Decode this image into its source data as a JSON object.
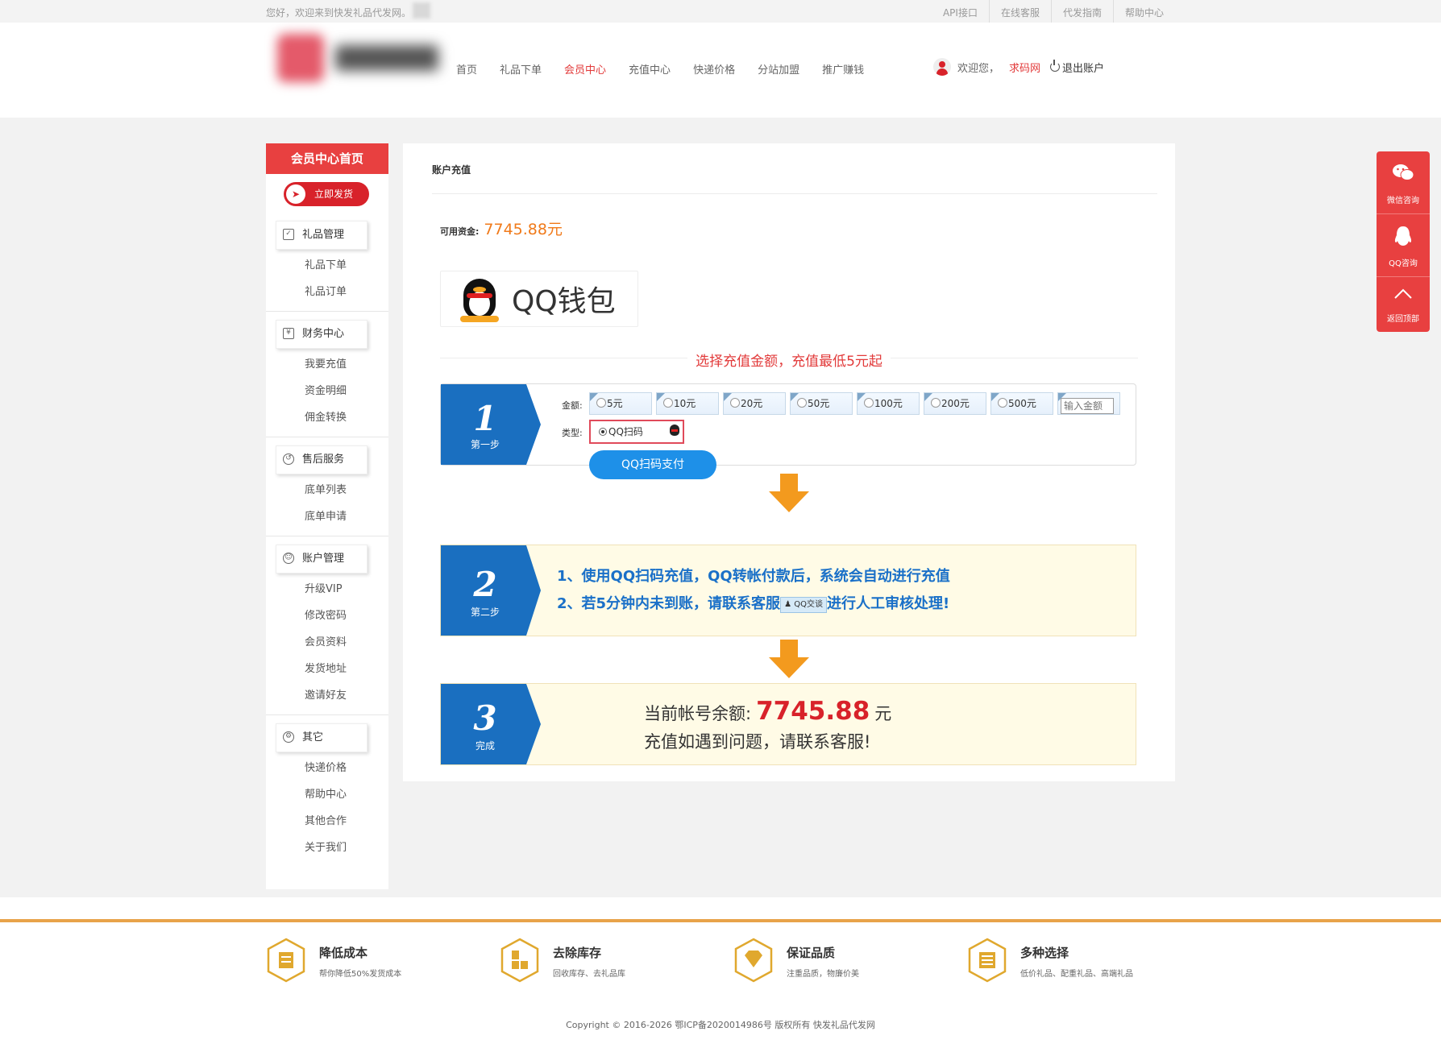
{
  "topbar": {
    "greeting": "您好，欢迎来到快发礼品代发网。",
    "links": [
      "API接口",
      "在线客服",
      "代发指南",
      "帮助中心"
    ]
  },
  "nav": {
    "items": [
      "首页",
      "礼品下单",
      "会员中心",
      "充值中心",
      "快递价格",
      "分站加盟",
      "推广赚钱"
    ],
    "active_index": 2
  },
  "user": {
    "welcome": "欢迎您，",
    "username": "求码网",
    "logout": "退出账户"
  },
  "sidebar": {
    "title": "会员中心首页",
    "ship_button": "立即发货",
    "groups": [
      {
        "head": "礼品管理",
        "icon": "gift-icon",
        "items": [
          "礼品下单",
          "礼品订单"
        ]
      },
      {
        "head": "财务中心",
        "icon": "yen-icon",
        "items": [
          "我要充值",
          "资金明细",
          "佣金转换"
        ]
      },
      {
        "head": "售后服务",
        "icon": "service-icon",
        "items": [
          "底单列表",
          "底单申请"
        ]
      },
      {
        "head": "账户管理",
        "icon": "users-icon",
        "items": [
          "升级VIP",
          "修改密码",
          "会员资料",
          "发货地址",
          "邀请好友"
        ]
      },
      {
        "head": "其它",
        "icon": "gear-icon",
        "items": [
          "快递价格",
          "帮助中心",
          "其他合作",
          "关于我们"
        ]
      }
    ]
  },
  "content": {
    "title": "账户充值",
    "available_label": "可用资金:",
    "available_amount": "7745.88元",
    "wallet_label": "QQ钱包",
    "section_title": "选择充值金额，充值最低5元起",
    "step1": {
      "num": "1",
      "label": "第一步",
      "amount_label": "金额:",
      "type_label": "类型:",
      "amount_options": [
        "5元",
        "10元",
        "20元",
        "50元",
        "100元",
        "200元",
        "500元"
      ],
      "custom_amount_placeholder": "输入金额",
      "type_option": "QQ扫码",
      "pay_button": "QQ扫码支付"
    },
    "step2": {
      "num": "2",
      "label": "第二步",
      "line1": "1、使用QQ扫码充值，QQ转帐付款后，系统会自动进行充值",
      "line2_a": "2、若5分钟内未到账，请联系客服",
      "qq_tag": "QQ交谈",
      "line2_b": "进行人工审核处理!"
    },
    "step3": {
      "num": "3",
      "label": "完成",
      "balance_label": "当前帐号余额:",
      "balance": "7745.88",
      "unit": "元",
      "help": "充值如遇到问题，请联系客服!"
    }
  },
  "float_bar": [
    "微信咨询",
    "QQ咨询",
    "返回顶部"
  ],
  "features": [
    {
      "title": "降低成本",
      "desc": "帮你降低50%发货成本"
    },
    {
      "title": "去除库存",
      "desc": "回收库存、去礼品库"
    },
    {
      "title": "保证品质",
      "desc": "注重品质，物廉价美"
    },
    {
      "title": "多种选择",
      "desc": "低价礼品、配重礼品、高端礼品"
    }
  ],
  "copyright": "Copyright © 2016-2026 鄂ICP备2020014986号 版权所有 快发礼品代发网",
  "colors": {
    "accent_red": "#e84040",
    "step_blue": "#1a6fc0",
    "pay_blue": "#1e90e8",
    "orange": "#f07a1a",
    "footer_line": "#e8a34a"
  }
}
